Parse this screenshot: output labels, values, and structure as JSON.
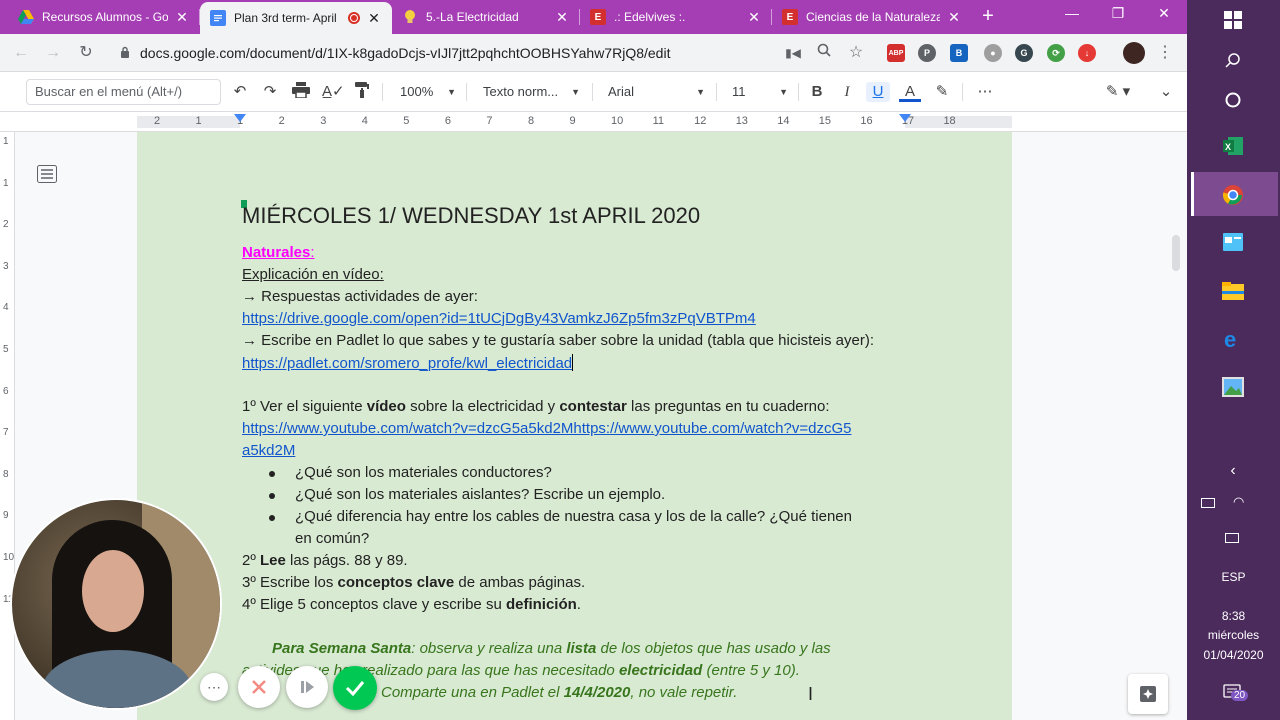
{
  "browser": {
    "tabs": [
      {
        "title": "Recursos Alumnos - Go",
        "icon": "google-drive-icon",
        "color": "#0f9d58"
      },
      {
        "title": "Plan 3rd term- April",
        "icon": "google-docs-icon",
        "color": "#4285f4",
        "active": true
      },
      {
        "title": "5.-La Electricidad",
        "icon": "lightbulb-icon",
        "color": "#f4b400"
      },
      {
        "title": ".: Edelvives :.",
        "icon": "edelvives-icon",
        "color": "#d32f2f"
      },
      {
        "title": "Ciencias de la Naturaleza",
        "icon": "edelvives-icon",
        "color": "#d32f2f"
      }
    ],
    "url": "docs.google.com/document/d/1IX-k8gadoDcjs-vIJl7jtt2pqhchtOOBHSYahw7RjQ8/edit",
    "accent": "#a53eb4"
  },
  "toolbar": {
    "search_placeholder": "Buscar en el menú (Alt+/)",
    "zoom": "100%",
    "style": "Texto norm...",
    "font": "Arial",
    "size": "11"
  },
  "ruler": {
    "numbers": [
      "2",
      "1",
      "1",
      "2",
      "3",
      "4",
      "5",
      "6",
      "7",
      "8",
      "9",
      "10",
      "11",
      "12",
      "13",
      "14",
      "15",
      "16",
      "17",
      "18"
    ]
  },
  "vruler": {
    "numbers": [
      "1",
      "1",
      "2",
      "3",
      "4",
      "5",
      "6",
      "7",
      "8",
      "9",
      "10",
      "11"
    ]
  },
  "document": {
    "heading": "MIÉRCOLES 1/ WEDNESDAY 1st  APRIL 2020",
    "subject": "Naturales",
    "subject_colon": ":",
    "video_label": "Explicación en vídeo:",
    "arrow1": "→ Respuestas actividades de ayer:",
    "link1": "https://drive.google.com/open?id=1tUCjDgBy43VamkzJ6Zp5fm3zPqVBTPm4",
    "arrow2": "→  Escribe en Padlet lo que sabes y te gustaría saber sobre la unidad (tabla que hicisteis ayer):",
    "link2": "https://padlet.com/sromero_profe/kwl_electricidad",
    "step1": {
      "pre": "1º Ver el siguiente ",
      "b1": "vídeo",
      "mid": " sobre la electricidad y ",
      "b2": "contestar",
      "post": " las preguntas en tu cuaderno:"
    },
    "link3a": "https://www.youtube.com/watch?v=dzcG5a5kd2Mhttps://www.youtube.com/watch?v=dzcG5",
    "link3b": "a5kd2M",
    "bullets": [
      "¿Qué son los materiales conductores?",
      "¿Qué son los materiales aislantes? Escribe un ejemplo.",
      "¿Qué diferencia hay entre los cables de nuestra casa y los de la calle? ¿Qué tienen",
      "en común?"
    ],
    "step2": {
      "pre": "2º ",
      "b": "Lee",
      "post": " las págs. 88 y 89."
    },
    "step3": {
      "pre": "3º Escribe los ",
      "b": "conceptos clave",
      "post": " de ambas páginas."
    },
    "step4": {
      "pre": "4º Elige 5 conceptos clave y escribe su ",
      "b": "definición",
      "post": "."
    },
    "easter": {
      "b1": "Para Semana Santa",
      "t1": ": observa y realiza una ",
      "b2": "lista",
      "t2": " de los objetos que has usado y las",
      "l2a": "activi",
      "l2b": "des que has realizado para las que has necesitado ",
      "b3": "electricidad",
      "t3": " (entre 5 y 10).",
      "l3": "Comparte una en Padlet el ",
      "b4": "14/4/2020",
      "t4": ", no vale repetir."
    }
  },
  "taskbar": {
    "lang": "ESP",
    "time": "8:38",
    "day": "miércoles",
    "date": "01/04/2020",
    "notifications": "20"
  }
}
